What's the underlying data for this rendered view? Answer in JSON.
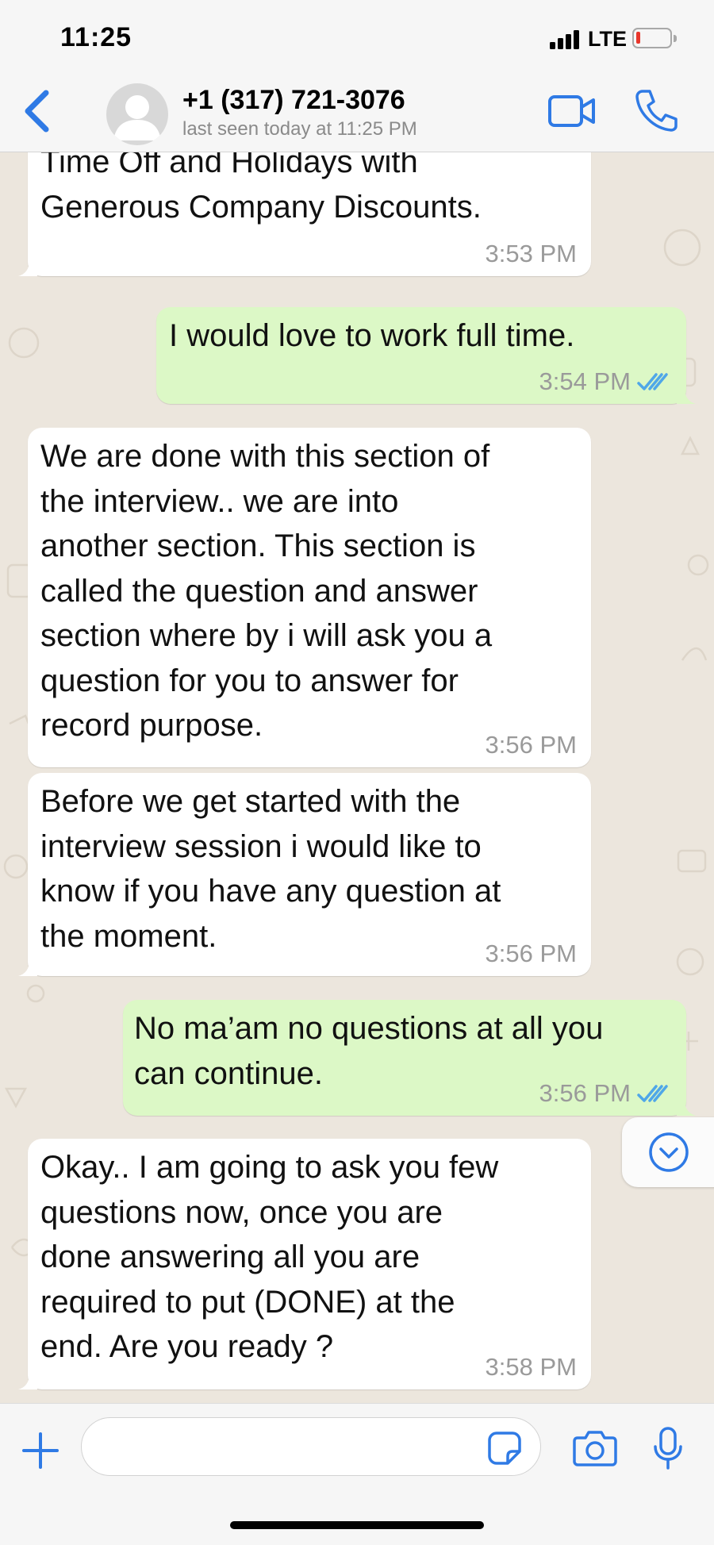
{
  "status_bar": {
    "time": "11:25",
    "network": "LTE",
    "battery_color": "#e8362b"
  },
  "header": {
    "back_icon": "chevron-left-icon",
    "contact_name": "+1 (317) 721-3076",
    "contact_status": "last seen today at 11:25 PM",
    "video_icon": "video-camera-icon",
    "call_icon": "phone-icon",
    "accent_color": "#2f7ae5"
  },
  "messages": [
    {
      "direction": "incoming",
      "text": "Time Off and Holidays with\nGenerous Company Discounts.",
      "time": "3:53 PM"
    },
    {
      "direction": "outgoing",
      "text": "I would love to work full time.",
      "time": "3:54 PM",
      "read": true
    },
    {
      "direction": "incoming",
      "text": "We are done with this section of\nthe interview.. we are into\nanother section. This section is\ncalled the question and answer\nsection where by i will ask you a\nquestion for you to answer for\nrecord purpose.",
      "time": "3:56 PM"
    },
    {
      "direction": "incoming",
      "text": "Before we get started with the\ninterview session i would like to\nknow if you have any question at\nthe moment.",
      "time": "3:56 PM"
    },
    {
      "direction": "outgoing",
      "text": "No ma’am no questions at all you\ncan continue.",
      "time": "3:56 PM",
      "read": true
    },
    {
      "direction": "incoming",
      "text": "Okay.. I am going to ask you few\nquestions now, once you are\ndone answering all you are\nrequired to put (DONE) at the\nend. Are you ready ?",
      "time": "3:58 PM"
    }
  ],
  "colors": {
    "incoming_bubble": "#ffffff",
    "outgoing_bubble": "#dcf8c6",
    "chat_background": "#ece6dd",
    "read_ticks": "#4fa7e8"
  },
  "input_bar": {
    "placeholder": "",
    "plus_icon": "plus-icon",
    "sticker_icon": "sticker-icon",
    "camera_icon": "camera-icon",
    "mic_icon": "microphone-icon"
  },
  "scroll_down_icon": "chevron-down-circle-icon"
}
